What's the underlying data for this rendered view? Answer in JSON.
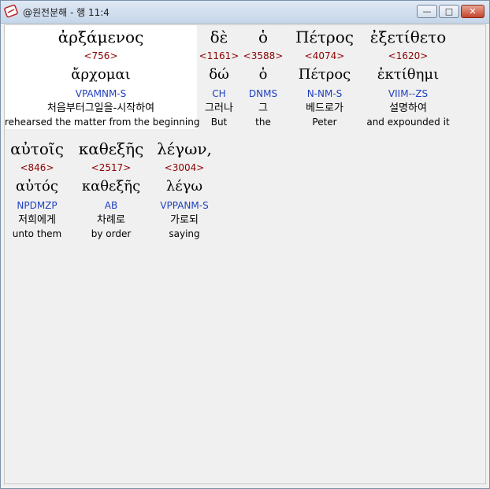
{
  "window": {
    "title": "@원전분해 - 행 11:4",
    "minimize_label": "—",
    "maximize_label": "□",
    "close_label": "✕"
  },
  "words": [
    {
      "greek": "ἀρξάμενος",
      "strong": "<756>",
      "lemma": "ἄρχομαι",
      "morph": "VPAMNM-S",
      "korean": "처음부터그일을-시작하여",
      "english": "rehearsed the matter from the beginning"
    },
    {
      "greek": "δὲ",
      "strong": "<1161>",
      "lemma": "δώ",
      "morph": "CH",
      "korean": "그러나",
      "english": "But"
    },
    {
      "greek": "ὁ",
      "strong": "<3588>",
      "lemma": "ὁ",
      "morph": "DNMS",
      "korean": "그",
      "english": "the"
    },
    {
      "greek": "Πέτρος",
      "strong": "<4074>",
      "lemma": "Πέτρος",
      "morph": "N-NM-S",
      "korean": "베드로가",
      "english": "Peter"
    },
    {
      "greek": "ἐξετίθετο",
      "strong": "<1620>",
      "lemma": "ἐκτίθημι",
      "morph": "VIIM--ZS",
      "korean": "설명하여",
      "english": "and expounded it"
    },
    {
      "greek": "αὐτοῖς",
      "strong": "<846>",
      "lemma": "αὐτός",
      "morph": "NPDMZP",
      "korean": "저희에게",
      "english": "unto them"
    },
    {
      "greek": "καθεξῆς",
      "strong": "<2517>",
      "lemma": "καθεξῆς",
      "morph": "AB",
      "korean": "차례로",
      "english": "by order"
    },
    {
      "greek": "λέγων,",
      "strong": "<3004>",
      "lemma": "λέγω",
      "morph": "VPPANM-S",
      "korean": "가로되",
      "english": "saying"
    }
  ]
}
